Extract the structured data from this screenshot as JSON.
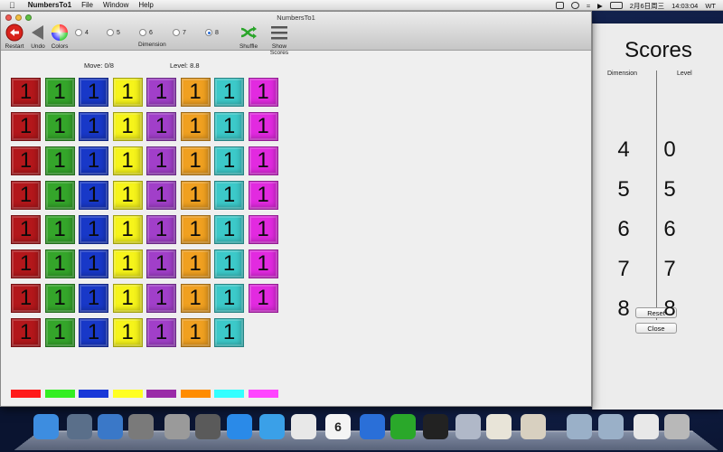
{
  "menubar": {
    "app_name": "NumbersTo1",
    "menus": [
      "File",
      "Window",
      "Help"
    ],
    "date": "2月6日周三",
    "time": "14:03:04",
    "user": "WT"
  },
  "window": {
    "title": "NumbersTo1",
    "toolbar": {
      "restart": "Restart",
      "undo": "Undo",
      "colors": "Colors",
      "dimension_label": "Dimension",
      "dimension_options": [
        "4",
        "5",
        "6",
        "7",
        "8"
      ],
      "selected_dimension": "8",
      "shuffle": "Shuffle",
      "show_scores": "Show Scores"
    },
    "status": {
      "move": "Move: 0/8",
      "level": "Level: 8.8"
    }
  },
  "board": {
    "colors": [
      "#b3171b",
      "#34a52a",
      "#1838c8",
      "#f6f41a",
      "#a13fc9",
      "#f0a020",
      "#3cc9c9",
      "#e22ae0"
    ],
    "rows": [
      [
        "1",
        "1",
        "1",
        "1",
        "1",
        "1",
        "1",
        "1"
      ],
      [
        "1",
        "1",
        "1",
        "1",
        "1",
        "1",
        "1",
        "1"
      ],
      [
        "1",
        "1",
        "1",
        "1",
        "1",
        "1",
        "1",
        "1"
      ],
      [
        "1",
        "1",
        "1",
        "1",
        "1",
        "1",
        "1",
        "1"
      ],
      [
        "1",
        "1",
        "1",
        "1",
        "1",
        "1",
        "1",
        "1"
      ],
      [
        "1",
        "1",
        "1",
        "1",
        "1",
        "1",
        "1",
        "1"
      ],
      [
        "1",
        "1",
        "1",
        "1",
        "1",
        "1",
        "1",
        "1"
      ],
      [
        "1",
        "1",
        "1",
        "1",
        "1",
        "1",
        "1"
      ]
    ],
    "swatches": [
      "#ff1a1a",
      "#33ee22",
      "#1838d8",
      "#ffff22",
      "#9a2aa8",
      "#ff8c00",
      "#33ffff",
      "#ff44ff"
    ]
  },
  "scores": {
    "title": "Scores",
    "col_dimension": "Dimension",
    "col_level": "Level",
    "dimensions": [
      "4",
      "5",
      "6",
      "7",
      "8"
    ],
    "levels": [
      "0",
      "5",
      "6",
      "7",
      "8"
    ],
    "reset": "Reset",
    "close": "Close"
  },
  "dock": {
    "items": [
      "finder-icon",
      "xcode-icon",
      "instruments-icon",
      "launchpad-icon",
      "keychain-icon",
      "migration-icon",
      "app-store-icon",
      "itunes-icon",
      "chrome-icon",
      "calendar-icon",
      "word-icon",
      "excel-icon",
      "qq-icon",
      "photos-icon",
      "textedit-icon",
      "script-icon",
      "folder-icon",
      "folder-icon",
      "zip-icon",
      "trash-icon"
    ],
    "calendar_day": "6"
  }
}
